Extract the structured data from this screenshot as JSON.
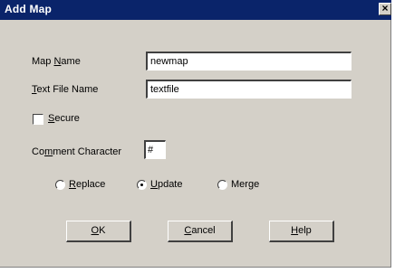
{
  "window": {
    "title": "Add Map",
    "close_glyph": "×"
  },
  "map_name": {
    "label_pre": "Map ",
    "label_key": "N",
    "label_post": "ame",
    "value": "newmap"
  },
  "text_file_name": {
    "label_pre": "",
    "label_key": "T",
    "label_post": "ext File Name",
    "value": "textfile"
  },
  "secure": {
    "label_pre": "",
    "label_key": "S",
    "label_post": "ecure",
    "checked": false
  },
  "comment_character": {
    "label_pre": "Co",
    "label_key": "m",
    "label_post": "ment Character",
    "value": "#"
  },
  "mode": {
    "selected": "Update",
    "options": [
      {
        "label_pre": "",
        "label_key": "R",
        "label_post": "eplace"
      },
      {
        "label_pre": "",
        "label_key": "U",
        "label_post": "pdate"
      },
      {
        "label_pre": "Mer",
        "label_key": "g",
        "label_post": "e"
      }
    ]
  },
  "buttons": {
    "ok": {
      "label_pre": "",
      "label_key": "O",
      "label_post": "K"
    },
    "cancel": {
      "label_pre": "",
      "label_key": "C",
      "label_post": "ancel"
    },
    "help": {
      "label_pre": "",
      "label_key": "H",
      "label_post": "elp"
    }
  }
}
